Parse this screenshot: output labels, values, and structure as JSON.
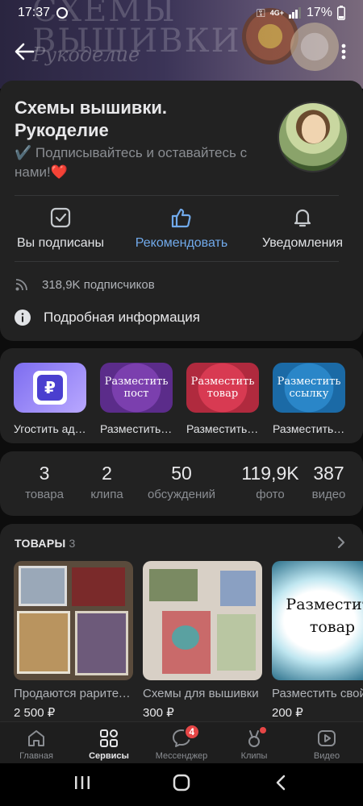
{
  "status_bar": {
    "time": "17:37",
    "battery": "17%",
    "network": "4G+"
  },
  "header": {
    "title": "Схемы вышивки. Рукоделие",
    "status": "✔️ Подписывайтесь и оставайтесь с нами!❤️",
    "cover_text": "СХЕМЫ ВЫШИВКИ",
    "cover_sub": "Рукоделие"
  },
  "actions": [
    {
      "label": "Вы подписаны",
      "icon": "checkbox-icon"
    },
    {
      "label": "Рекомендовать",
      "icon": "thumbs-up-icon"
    },
    {
      "label": "Уведомления",
      "icon": "bell-icon"
    }
  ],
  "info": {
    "subscribers": "318,9K подписчиков",
    "details": "Подробная информация"
  },
  "services": [
    {
      "label": "Угостить админа",
      "caption": "",
      "icon": "ruble-icon"
    },
    {
      "label": "Разместить пост",
      "caption": "Разместить пост"
    },
    {
      "label": "Разместить товар",
      "caption": "Разместить товар"
    },
    {
      "label": "Разместить ссылку",
      "caption": "Разместить ссылку"
    }
  ],
  "counters": [
    {
      "num": "3",
      "cap": "товара"
    },
    {
      "num": "2",
      "cap": "клипа"
    },
    {
      "num": "50",
      "cap": "обсуждений"
    },
    {
      "num": "119,9K",
      "cap": "фото"
    },
    {
      "num": "387",
      "cap": "видео"
    }
  ],
  "goods": {
    "heading": "ТОВАРЫ",
    "count": "3",
    "items": [
      {
        "title": "Продаются раритетные наборы",
        "price": "2 500 ₽"
      },
      {
        "title": "Схемы для вышивки",
        "price": "300 ₽"
      },
      {
        "title": "Разместить свой товар",
        "price": "200 ₽",
        "overlay": "Разместить товар"
      }
    ]
  },
  "tabbar": [
    {
      "label": "Главная",
      "icon": "home-icon"
    },
    {
      "label": "Сервисы",
      "icon": "services-icon",
      "active": true
    },
    {
      "label": "Мессенджер",
      "icon": "messenger-icon",
      "badge": "4"
    },
    {
      "label": "Клипы",
      "icon": "clips-icon"
    },
    {
      "label": "Видео",
      "icon": "video-icon"
    }
  ],
  "colors": {
    "accent": "#71aaeb",
    "background": "#0d0d0d",
    "card": "#222222",
    "badge": "#e64646"
  }
}
